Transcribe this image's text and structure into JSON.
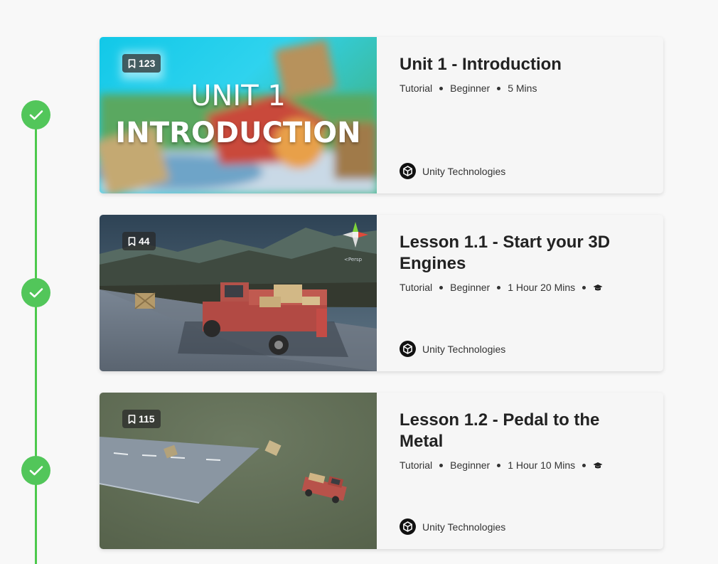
{
  "accent_color": "#52c65a",
  "courses": [
    {
      "title": "Unit 1 - Introduction",
      "bookmarks": "123",
      "thumb_line1": "UNIT 1",
      "thumb_line2": "INTRODUCTION",
      "type": "Tutorial",
      "level": "Beginner",
      "duration": "5 Mins",
      "has_cap_icon": false,
      "publisher": "Unity Technologies",
      "completed": true
    },
    {
      "title": "Lesson 1.1 - Start your 3D Engines",
      "bookmarks": "44",
      "type": "Tutorial",
      "level": "Beginner",
      "duration": "1 Hour 20 Mins",
      "has_cap_icon": true,
      "publisher": "Unity Technologies",
      "completed": true,
      "scene_label": "<Persp"
    },
    {
      "title": "Lesson 1.2 - Pedal to the Metal",
      "bookmarks": "115",
      "type": "Tutorial",
      "level": "Beginner",
      "duration": "1 Hour 10 Mins",
      "has_cap_icon": true,
      "publisher": "Unity Technologies",
      "completed": true
    }
  ],
  "icons": {
    "check": "check-icon",
    "bookmark": "bookmark-icon",
    "cap": "graduation-cap-icon",
    "publisher_logo": "unity-logo-icon"
  }
}
